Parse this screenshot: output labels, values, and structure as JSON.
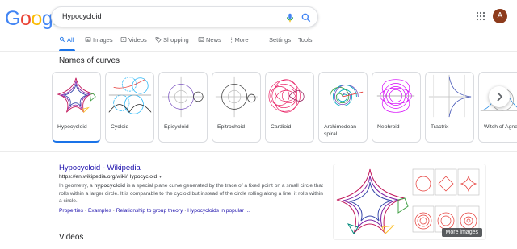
{
  "header": {
    "logo_letters": [
      "G",
      "o",
      "o",
      "g",
      "l",
      "e"
    ],
    "logo_colors": [
      "#4285f4",
      "#ea4335",
      "#fbbc05",
      "#4285f4",
      "#34a853",
      "#ea4335"
    ],
    "query": "Hypocycloid",
    "avatar_initial": "A",
    "icons": [
      "mic-icon",
      "search-icon",
      "apps-grid-icon"
    ]
  },
  "tabs": {
    "items": [
      {
        "label": "All",
        "icon": "search-icon",
        "active": true
      },
      {
        "label": "Images",
        "icon": "image-icon"
      },
      {
        "label": "Videos",
        "icon": "video-icon"
      },
      {
        "label": "Shopping",
        "icon": "tag-icon"
      },
      {
        "label": "News",
        "icon": "news-icon"
      },
      {
        "label": "More",
        "icon": "more-vertical-icon"
      }
    ],
    "settings": "Settings",
    "tools": "Tools",
    "accent": "#1a73e8"
  },
  "curves": {
    "title": "Names of curves",
    "cards": [
      {
        "label": "Hypocycloid"
      },
      {
        "label": "Cycloid"
      },
      {
        "label": "Epicycloid"
      },
      {
        "label": "Epitrochoid"
      },
      {
        "label": "Cardioid"
      },
      {
        "label": "Archimedean spiral"
      },
      {
        "label": "Nephroid"
      },
      {
        "label": "Tractrix"
      },
      {
        "label": "Witch of Agnesi"
      }
    ],
    "next_icon": "chevron-right-icon"
  },
  "result": {
    "title": "Hypocycloid - Wikipedia",
    "url": "https://en.wikipedia.org/wiki/Hypocycloid",
    "url_caret": "▾",
    "snippet_pre": "In geometry, a ",
    "snippet_bold": "hypocycloid",
    "snippet_post": " is a special plane curve generated by the trace of a fixed point on a small circle that rolls within a larger circle. It is comparable to the cycloid but instead of the circle rolling along a line, it rolls within a circle.",
    "links": [
      "Properties",
      "Examples",
      "Relationship to group theory",
      "Hypocycloids in popular ..."
    ],
    "link_separator": "·"
  },
  "image_panel": {
    "more_images": "More images"
  },
  "videos": {
    "title": "Videos"
  }
}
